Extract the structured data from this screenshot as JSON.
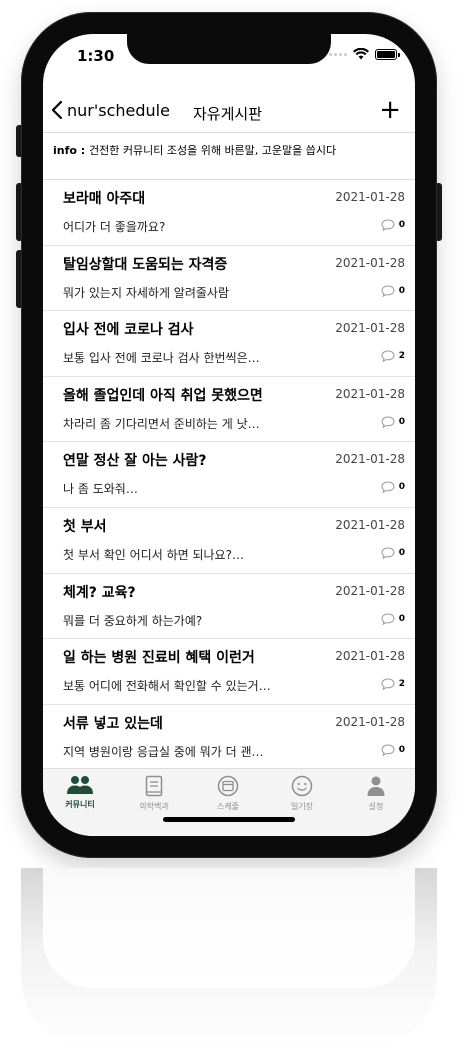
{
  "status_bar": {
    "time": "1:30"
  },
  "nav": {
    "back_label": "nur'schedule",
    "title": "자유게시판",
    "add_label": "+"
  },
  "info": {
    "label": "info : ",
    "text": "건전한 커뮤니티 조성을 위해 바른말, 고운말을 씁시다"
  },
  "posts": [
    {
      "title": "보라매 아주대",
      "date": "2021-01-28",
      "preview": "어디가 더 좋을까요?",
      "comments": "0"
    },
    {
      "title": "탈임상할대 도움되는 자격증",
      "date": "2021-01-28",
      "preview": "뭐가 있는지 자세하게 알려줄사람",
      "comments": "0"
    },
    {
      "title": "입사 전에 코로나 검사",
      "date": "2021-01-28",
      "preview": "보통 입사 전에 코로나 검사 한번씩은…",
      "comments": "2"
    },
    {
      "title": "올해 졸업인데 아직 취업 못했으면",
      "date": "2021-01-28",
      "preview": "차라리 좀 기다리면서 준비하는 게 낫…",
      "comments": "0"
    },
    {
      "title": "연말 정산 잘 아는 사람?",
      "date": "2021-01-28",
      "preview": "나 좀 도와줘…",
      "comments": "0"
    },
    {
      "title": "첫 부서",
      "date": "2021-01-28",
      "preview": "첫 부서 확인 어디서 하면 되나요?…",
      "comments": "0"
    },
    {
      "title": "체계? 교육?",
      "date": "2021-01-28",
      "preview": "뭐를 더 중요하게 하는가예?",
      "comments": "0"
    },
    {
      "title": "일 하는 병원 진료비 혜택 이런거",
      "date": "2021-01-28",
      "preview": "보통 어디에 전화해서 확인할 수 있는거…",
      "comments": "2"
    },
    {
      "title": "서류 넣고 있는데",
      "date": "2021-01-28",
      "preview": "지역 병원이랑 응급실 중에 뭐가 더 괜…",
      "comments": "0"
    }
  ],
  "tabs": [
    {
      "label": "커뮤니티",
      "icon": "community-icon",
      "active": true
    },
    {
      "label": "의학백과",
      "icon": "book-icon",
      "active": false
    },
    {
      "label": "스케줄",
      "icon": "calendar-icon",
      "active": false
    },
    {
      "label": "일기장",
      "icon": "smile-icon",
      "active": false
    },
    {
      "label": "설정",
      "icon": "person-icon",
      "active": false
    }
  ],
  "colors": {
    "active_tab": "#1f4d3a",
    "inactive_tab": "#8f8f8f",
    "phone_body": "#0b0b0b"
  }
}
